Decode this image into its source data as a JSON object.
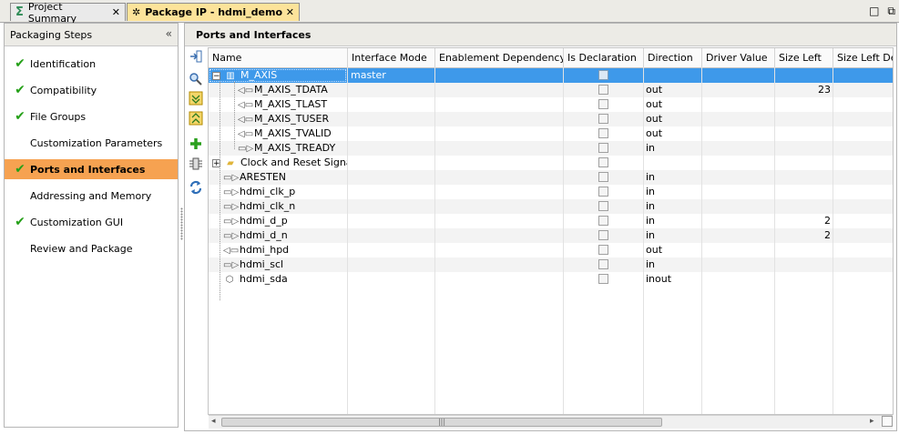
{
  "tabs": [
    {
      "label": "Project Summary",
      "close": "✕"
    },
    {
      "label": "Package IP - hdmi_demo",
      "close": "✕"
    }
  ],
  "window_controls": {
    "restore": "□",
    "maximize": "⧉"
  },
  "left_panel": {
    "title": "Packaging Steps",
    "collapse": "«",
    "steps": [
      {
        "label": "Identification",
        "checked": true
      },
      {
        "label": "Compatibility",
        "checked": true
      },
      {
        "label": "File Groups",
        "checked": true
      },
      {
        "label": "Customization Parameters",
        "checked": false
      },
      {
        "label": "Ports and Interfaces",
        "checked": true,
        "active": true
      },
      {
        "label": "Addressing and Memory",
        "checked": false
      },
      {
        "label": "Customization GUI",
        "checked": true
      },
      {
        "label": "Review and Package",
        "checked": false
      }
    ]
  },
  "right_panel": {
    "title": "Ports and Interfaces"
  },
  "table": {
    "columns": [
      "Name",
      "Interface Mode",
      "Enablement Dependency",
      "Is Declaration",
      "Direction",
      "Driver Value",
      "Size Left",
      "Size Left Dep"
    ],
    "rows": [
      {
        "name": "M_AXIS",
        "mode": "master",
        "direction": "",
        "size_left": "",
        "level": 0,
        "expander": "−",
        "icon": "bus-interface-icon",
        "selected": true
      },
      {
        "name": "M_AXIS_TDATA",
        "mode": "",
        "direction": "out",
        "size_left": "23",
        "level": 2,
        "icon": "port-out-icon"
      },
      {
        "name": "M_AXIS_TLAST",
        "mode": "",
        "direction": "out",
        "size_left": "",
        "level": 2,
        "icon": "port-out-icon"
      },
      {
        "name": "M_AXIS_TUSER",
        "mode": "",
        "direction": "out",
        "size_left": "",
        "level": 2,
        "icon": "port-out-icon"
      },
      {
        "name": "M_AXIS_TVALID",
        "mode": "",
        "direction": "out",
        "size_left": "",
        "level": 2,
        "icon": "port-out-icon"
      },
      {
        "name": "M_AXIS_TREADY",
        "mode": "",
        "direction": "in",
        "size_left": "",
        "level": 2,
        "icon": "port-in-icon"
      },
      {
        "name": "Clock and Reset Signals",
        "mode": "",
        "direction": "",
        "size_left": "",
        "level": 0,
        "expander": "+",
        "icon": "folder-icon"
      },
      {
        "name": "ARESTEN",
        "mode": "",
        "direction": "in",
        "size_left": "",
        "level": 1,
        "icon": "port-in-icon"
      },
      {
        "name": "hdmi_clk_p",
        "mode": "",
        "direction": "in",
        "size_left": "",
        "level": 1,
        "icon": "port-in-icon"
      },
      {
        "name": "hdmi_clk_n",
        "mode": "",
        "direction": "in",
        "size_left": "",
        "level": 1,
        "icon": "port-in-icon"
      },
      {
        "name": "hdmi_d_p",
        "mode": "",
        "direction": "in",
        "size_left": "2",
        "level": 1,
        "icon": "port-in-icon"
      },
      {
        "name": "hdmi_d_n",
        "mode": "",
        "direction": "in",
        "size_left": "2",
        "level": 1,
        "icon": "port-in-icon"
      },
      {
        "name": "hdmi_hpd",
        "mode": "",
        "direction": "out",
        "size_left": "",
        "level": 1,
        "icon": "port-out-icon"
      },
      {
        "name": "hdmi_scl",
        "mode": "",
        "direction": "in",
        "size_left": "",
        "level": 1,
        "icon": "port-in-icon"
      },
      {
        "name": "hdmi_sda",
        "mode": "",
        "direction": "inout",
        "size_left": "",
        "level": 1,
        "icon": "port-inout-icon"
      }
    ]
  },
  "scrollbar": {
    "left_arrow": "◂",
    "right_arrow": "▸",
    "grip": "|||"
  },
  "colors": {
    "selection": "#3e99ea",
    "active_step": "#f6a251",
    "check": "#25a018",
    "active_tab": "#fce39a"
  }
}
